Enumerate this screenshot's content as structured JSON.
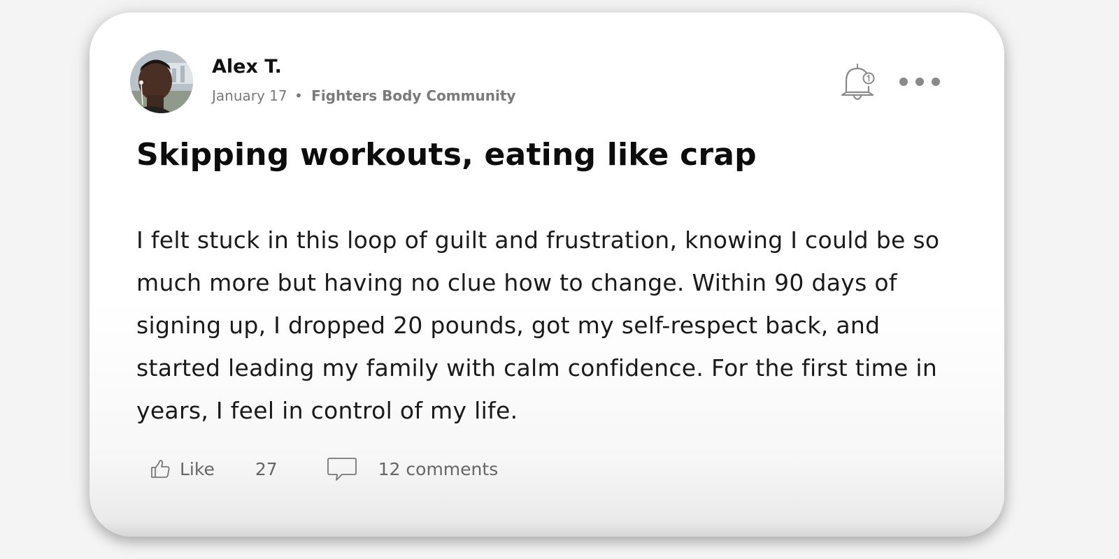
{
  "post": {
    "author": "Alex T.",
    "date": "January 17",
    "separator": "•",
    "community": "Fighters Body Community",
    "title": "Skipping workouts, eating like crap",
    "body": "I felt stuck in this loop of guilt and frustration, knowing I could be so much more but having no clue how to change. Within 90 days of signing up, I dropped 20 pounds, got my self-respect back, and started leading my family with calm confidence. For the first time in years, I feel in control of my life."
  },
  "actions": {
    "like_label": "Like",
    "like_count": "27",
    "comments_label": "12 comments"
  },
  "icons": {
    "bell": "bell-icon",
    "more": "more-options-icon",
    "like": "thumbs-up-icon",
    "comment": "comment-bubble-icon"
  },
  "colors": {
    "card_background": "#ffffff",
    "page_background": "#f4f4f4",
    "muted_text": "#7a7a7a",
    "icon_gray": "#8a8a8a"
  }
}
